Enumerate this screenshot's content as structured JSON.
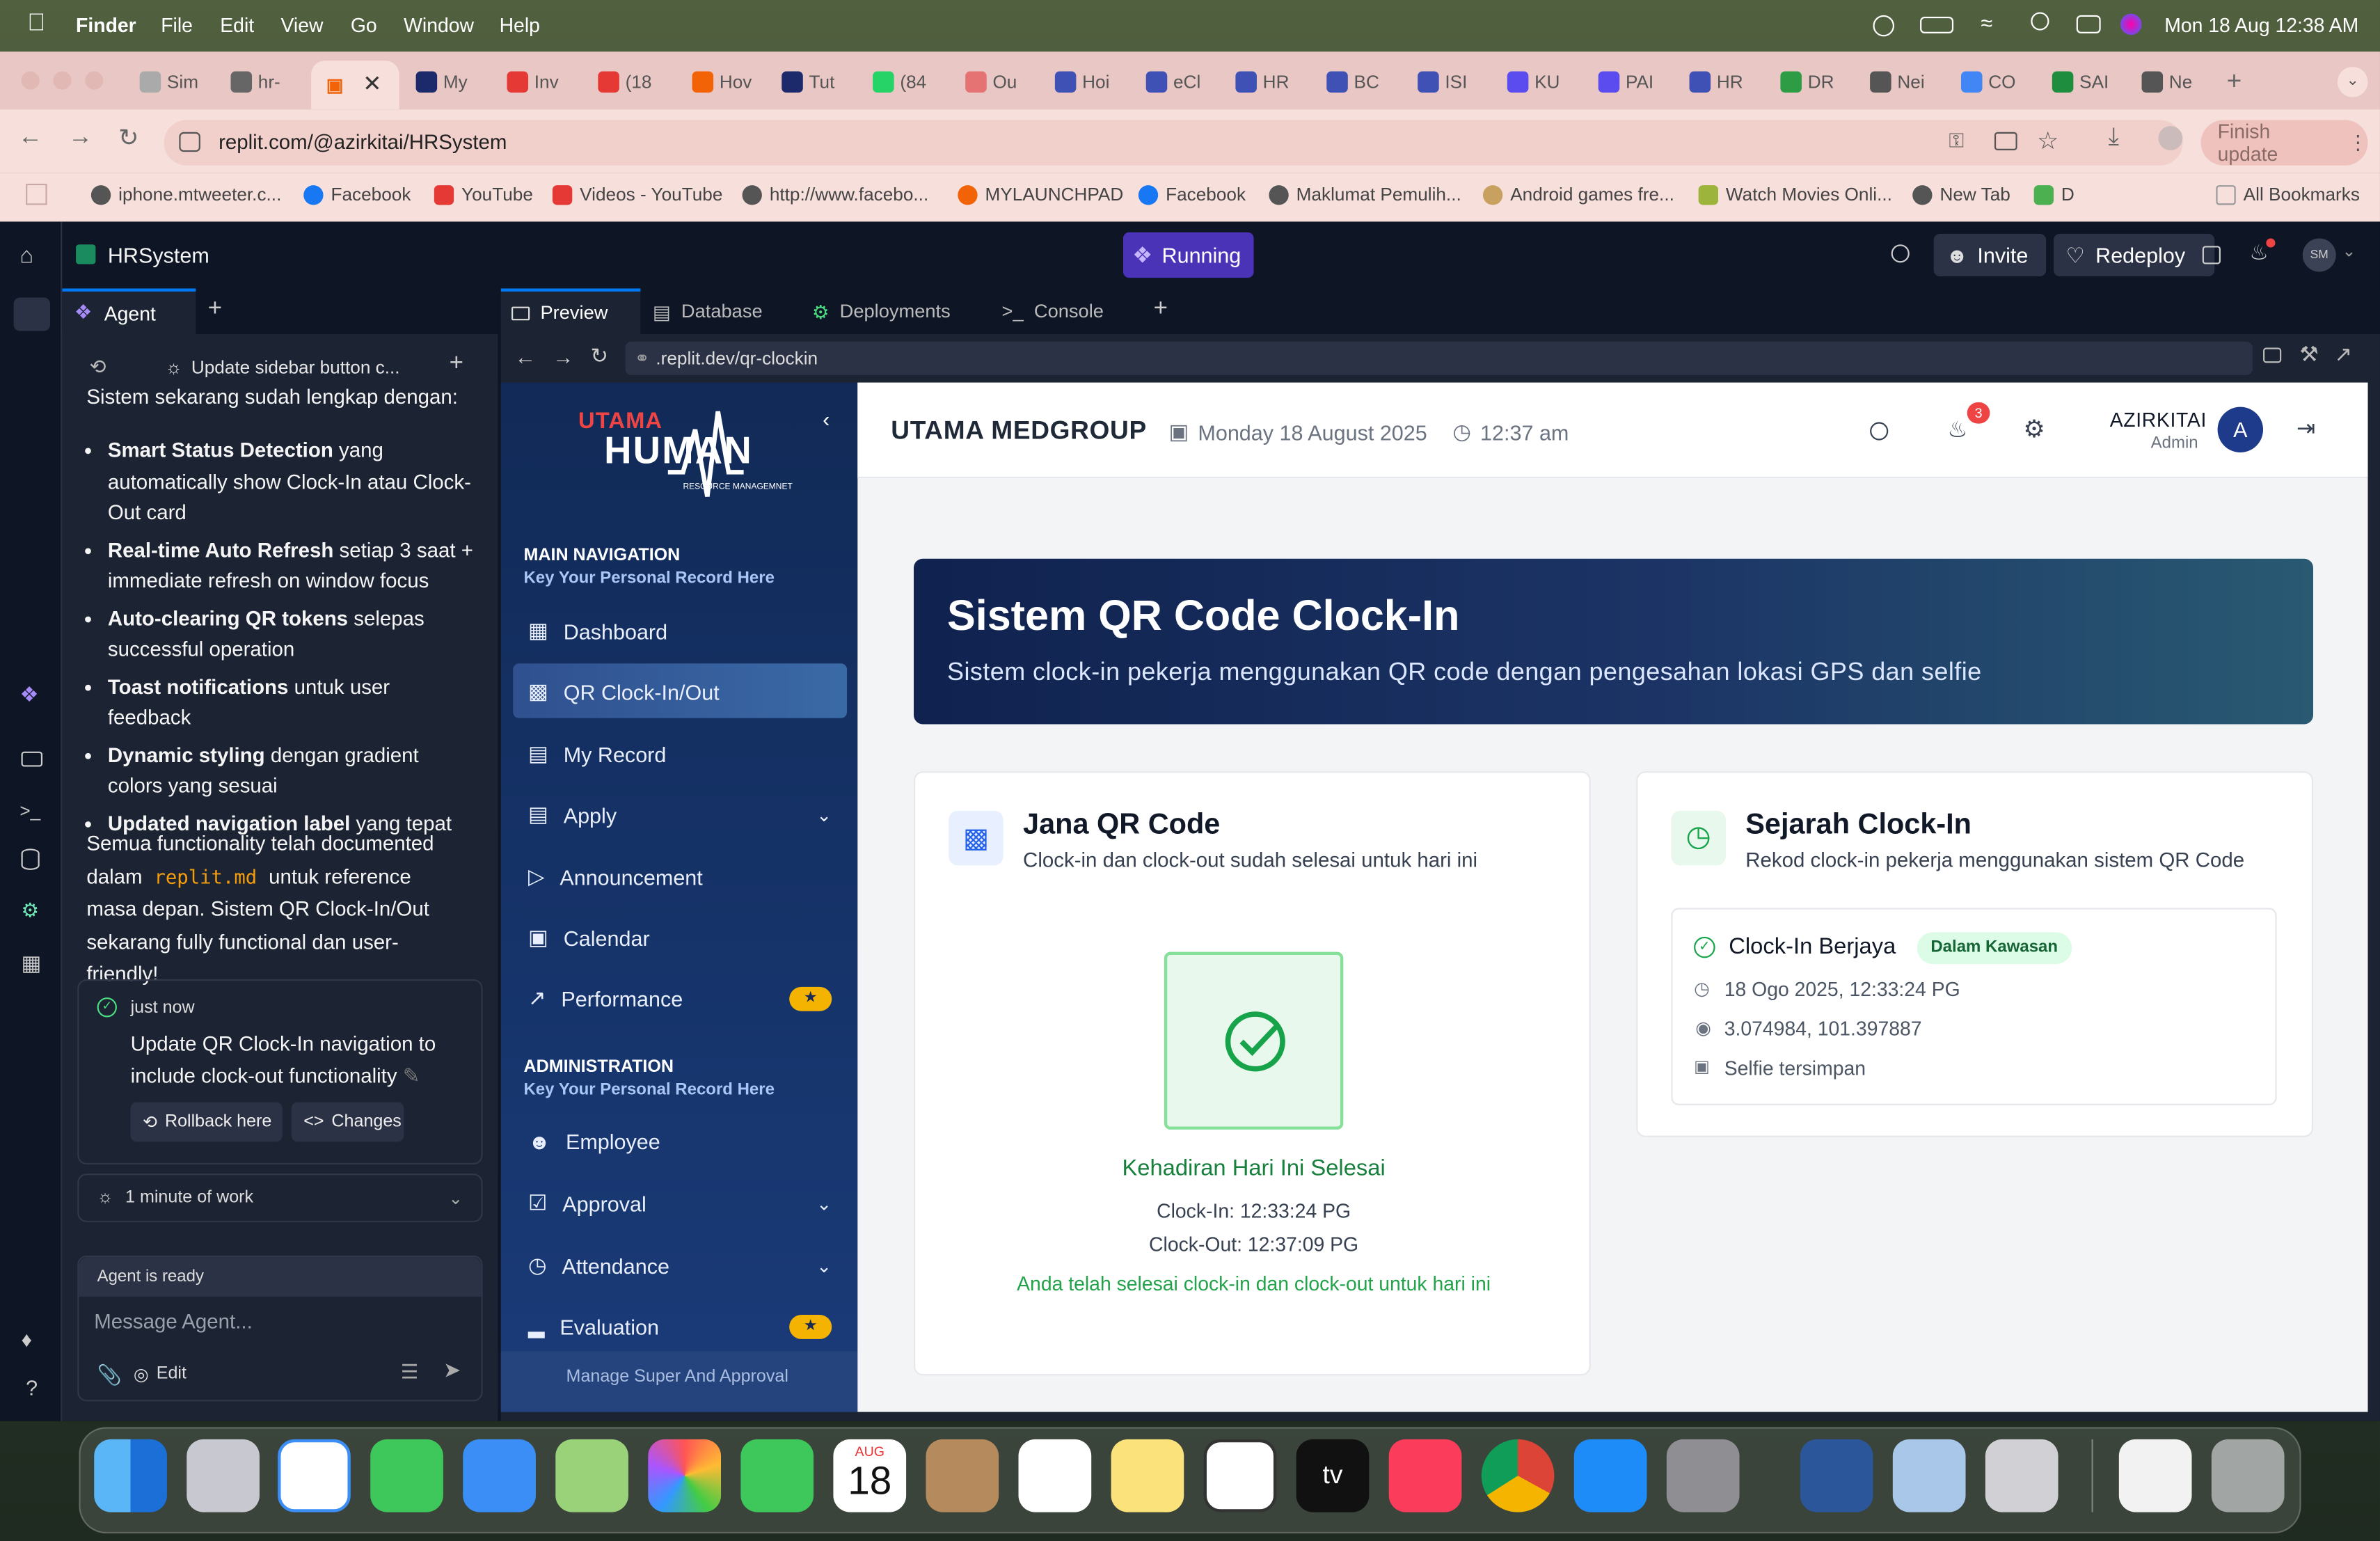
{
  "mac_menubar": {
    "app": "Finder",
    "menus": [
      "File",
      "Edit",
      "View",
      "Go",
      "Window",
      "Help"
    ],
    "clock": "Mon 18 Aug  12:38 AM"
  },
  "browser": {
    "tabs": [
      "Sim",
      "hr-",
      "",
      "My",
      "Inv",
      "(18",
      "Hov",
      "Tut",
      "(84",
      "Ou",
      "Hoi",
      "eCl",
      "HR",
      "BC",
      "ISI",
      "KU",
      "PAI",
      "HR",
      "DR",
      "Nei",
      "CO",
      "SAI",
      "Ne"
    ],
    "url": "replit.com/@azirkitai/HRSystem",
    "finish_update": "Finish update",
    "bookmarks": [
      "iphone.mtweeter.c...",
      "Facebook",
      "YouTube",
      "Videos - YouTube",
      "http://www.facebo...",
      "MYLAUNCHPAD",
      "Facebook",
      "Maklumat Pemulih...",
      "Android games fre...",
      "Watch Movies Onli...",
      "New Tab",
      "D"
    ],
    "all_bookmarks": "All Bookmarks"
  },
  "replit": {
    "project": "HRSystem",
    "status": "Running",
    "invite": "Invite",
    "redeploy": "Redeploy",
    "avatar": "SM",
    "agent_tab": "Agent",
    "history_title": "Update sidebar button c...",
    "agent_intro": "Sistem sekarang sudah lengkap dengan:",
    "bullets": [
      {
        "bold": "Smart Status Detection",
        "rest": " yang automatically show Clock-In atau Clock-Out card"
      },
      {
        "bold": "Real-time Auto Refresh",
        "rest": " setiap 3 saat + immediate refresh on window focus"
      },
      {
        "bold": "Auto-clearing QR tokens",
        "rest": " selepas successful operation"
      },
      {
        "bold": "Toast notifications",
        "rest": " untuk user feedback"
      },
      {
        "bold": "Dynamic styling",
        "rest": " dengan gradient colors yang sesuai"
      },
      {
        "bold": "Updated navigation label",
        "rest": " yang tepat"
      }
    ],
    "summary_a": "Semua functionality telah documented dalam ",
    "summary_code": "replit.md",
    "summary_b": " untuk reference masa depan. Sistem QR Clock-In/Out sekarang fully functional dan user-friendly!",
    "checkpoint_time": "just now",
    "checkpoint_msg": "Update QR Clock-In navigation to include clock-out functionality",
    "rollback": "Rollback here",
    "changes": "Changes",
    "work_time": "1 minute of work",
    "agent_ready": "Agent is ready",
    "message_placeholder": "Message Agent...",
    "edit": "Edit",
    "pane_tabs": [
      "Preview",
      "Database",
      "Deployments",
      "Console"
    ],
    "preview_url": ".replit.dev/qr-clockin"
  },
  "hr": {
    "logo_top": "UTAMA",
    "logo_main": "HUMAN",
    "logo_sub": "RESOURCE MANAGEMNET",
    "main_nav_title": "MAIN NAVIGATION",
    "nav_subtitle": "Key Your Personal Record Here",
    "main_nav": [
      "Dashboard",
      "QR Clock-In/Out",
      "My Record",
      "Apply",
      "Announcement",
      "Calendar",
      "Performance"
    ],
    "admin_title": "ADMINISTRATION",
    "admin_nav": [
      "Employee",
      "Approval",
      "Attendance",
      "Evaluation"
    ],
    "footer": "Manage Super And Approval",
    "company": "UTAMA MEDGROUP",
    "date": "Monday 18 August 2025",
    "time": "12:37 am",
    "notif_count": "3",
    "user_name": "AZIRKITAI",
    "user_role": "Admin",
    "user_initial": "A",
    "hero_title": "Sistem QR Code Clock-In",
    "hero_subtitle": "Sistem clock-in pekerja menggunakan QR code dengan pengesahan lokasi GPS dan selfie",
    "qr_title": "Jana QR Code",
    "qr_subtitle": "Clock-in dan clock-out sudah selesai untuk hari ini",
    "done_title": "Kehadiran Hari Ini Selesai",
    "clock_in": "Clock-In: 12:33:24 PG",
    "clock_out": "Clock-Out: 12:37:09 PG",
    "done_note": "Anda telah selesai clock-in dan clock-out untuk hari ini",
    "history_title": "Sejarah Clock-In",
    "history_subtitle": "Rekod clock-in pekerja menggunakan sistem QR Code",
    "entry_title": "Clock-In Berjaya",
    "entry_badge": "Dalam Kawasan",
    "entry_time": "18 Ogo 2025, 12:33:24 PG",
    "entry_coords": "3.074984, 101.397887",
    "entry_selfie": "Selfie tersimpan"
  },
  "dock": {
    "calendar_month": "AUG",
    "calendar_day": "18",
    "tv": "tv"
  }
}
